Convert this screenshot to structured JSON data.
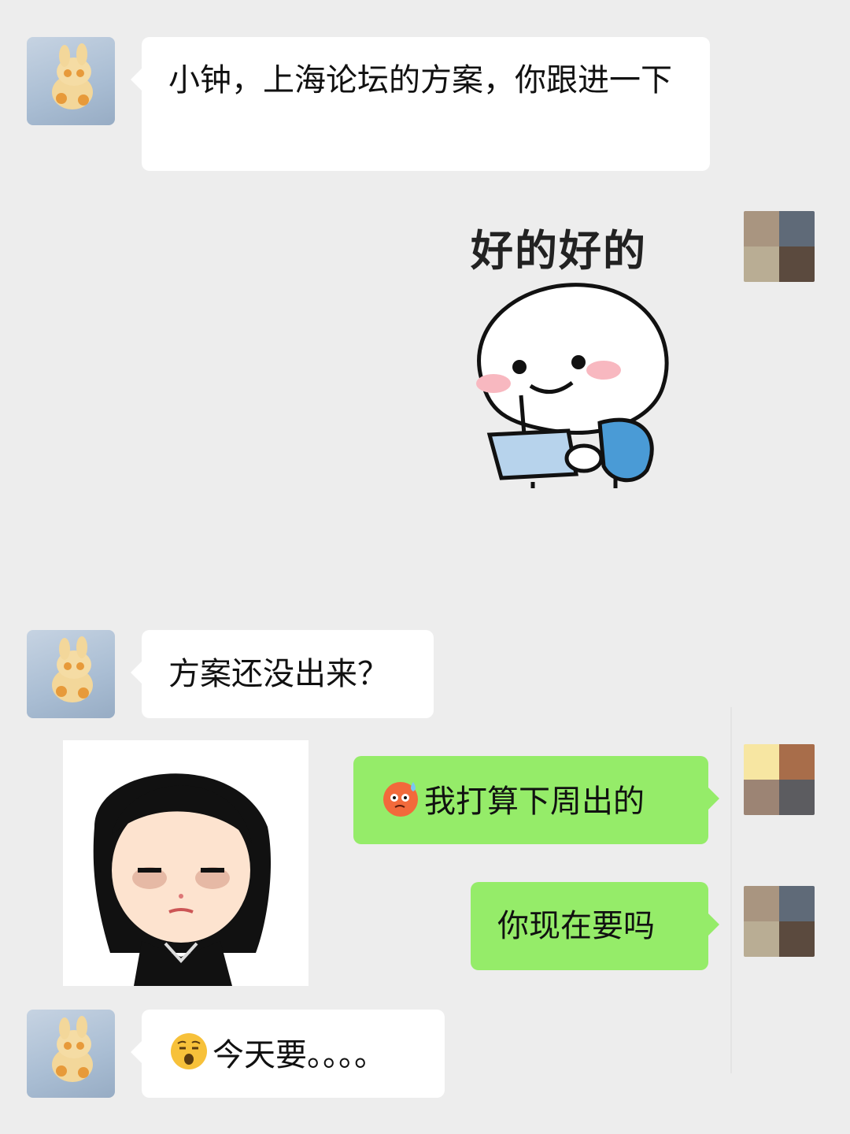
{
  "messages": [
    {
      "side": "left",
      "text": "小钟，上海论坛的方案，你跟进一下"
    },
    {
      "side": "right",
      "type": "sticker",
      "caption": "好的好的"
    },
    {
      "side": "left",
      "text": "方案还没出来？"
    },
    {
      "side": "left",
      "type": "sticker",
      "description_icon": "tired-girl-sticker"
    },
    {
      "side": "right",
      "text": "我打算下周出的",
      "emoji": "sweat-angry-face-icon"
    },
    {
      "side": "right",
      "text": "你现在要吗"
    },
    {
      "side": "left",
      "text": "今天要。。。。",
      "emoji": "sleepy-face-icon"
    }
  ],
  "colors": {
    "background": "#EDEDED",
    "left_bubble": "#FFFFFF",
    "right_bubble": "#95EC69"
  }
}
